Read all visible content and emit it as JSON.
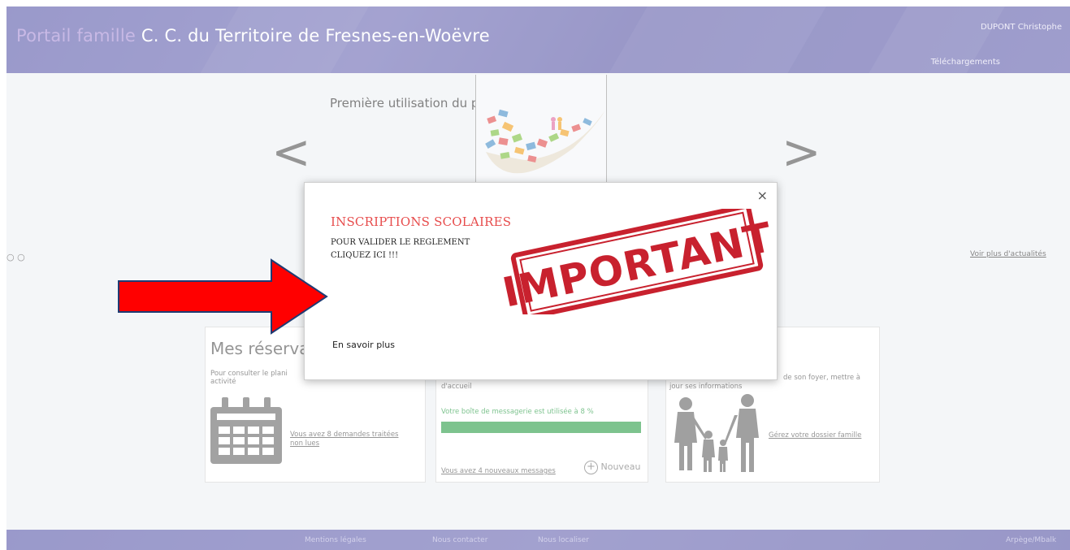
{
  "header": {
    "brand": "Portail famille",
    "title": " C. C. du Territoire de Fresnes-en-Woëvre",
    "user": "DUPONT Christophe",
    "downloads": "Téléchargements"
  },
  "carousel": {
    "title": "Première utilisation du portail famille",
    "more_news": "Voir plus d'actualités"
  },
  "cards": {
    "reservations": {
      "heading": "Mes réservati",
      "text": "Pour consulter le plani",
      "text2": "activité",
      "link": "Vous avez 8 demandes traitées non lues"
    },
    "messages": {
      "text": "d'accueil",
      "usage": "Votre boîte de messagerie est utilisée à 8 %",
      "usage_percent": 8,
      "new_messages_link": "Vous avez 4 nouveaux messages",
      "new_button": "Nouveau"
    },
    "family": {
      "text_right": "de son foyer, mettre à",
      "text": "jour ses informations",
      "link": "Gérez votre dossier famille"
    }
  },
  "footer": {
    "legal": "Mentions légales",
    "contact": "Nous contacter",
    "locate": "Nous localiser",
    "credit": "Arpège/Mbalk"
  },
  "modal": {
    "title": "INSCRIPTIONS SCOLAIRES",
    "line1": "POUR VALIDER LE REGLEMENT",
    "line2": "CLIQUEZ ICI !!!",
    "stamp_text": "IMPORTANT",
    "learn_more": "En savoir plus",
    "close": "×"
  },
  "colors": {
    "header": "#5c5bab",
    "brand_accent": "#a78ed6",
    "modal_title": "#e74c4c",
    "stamp": "#c8212e",
    "arrow": "#ff0000",
    "progress": "#2e9e4a"
  }
}
